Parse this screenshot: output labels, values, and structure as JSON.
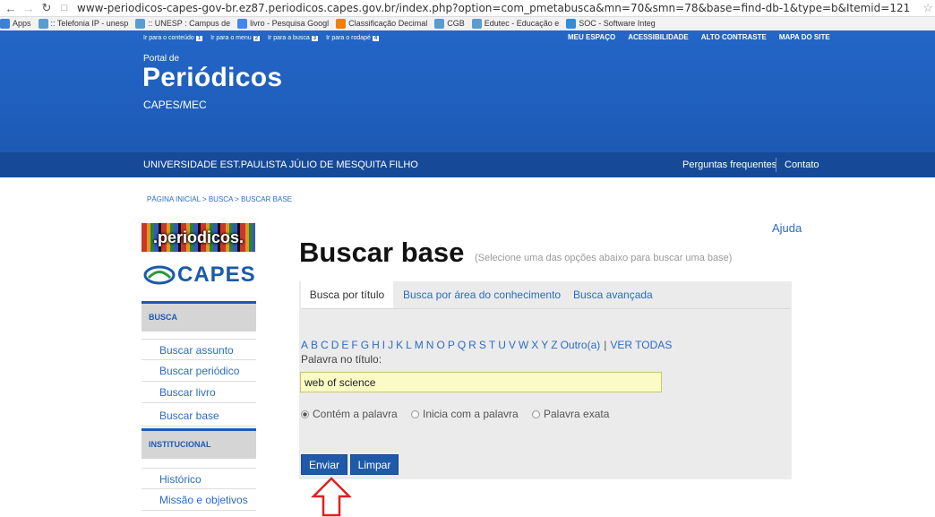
{
  "browser": {
    "url": "www-periodicos-capes-gov-br.ez87.periodicos.capes.gov.br/index.php?option=com_pmetabusca&mn=70&smn=78&base=find-db-1&type=b&Itemid=121",
    "bookmarks": [
      {
        "label": "Apps",
        "icon": "apps-grid-icon",
        "color": "#3b82d6"
      },
      {
        "label": ":: Telefonia IP - unesp",
        "icon": "unesp-icon",
        "color": "#5b9bd5"
      },
      {
        "label": ":: UNESP : Campus de",
        "icon": "unesp-icon",
        "color": "#5b9bd5"
      },
      {
        "label": "livro - Pesquisa Googl",
        "icon": "google-icon",
        "color": "#4285f4"
      },
      {
        "label": "Classificação Decimal",
        "icon": "blogger-icon",
        "color": "#f57d00"
      },
      {
        "label": "CGB",
        "icon": "unesp-icon",
        "color": "#5b9bd5"
      },
      {
        "label": "Edutec - Educação e",
        "icon": "unesp-icon",
        "color": "#5b9bd5"
      },
      {
        "label": "SOC - Software Integ",
        "icon": "soc-icon",
        "color": "#2e8fd6"
      }
    ]
  },
  "header": {
    "skip_links": [
      {
        "label": "Ir para o conteúdo",
        "num": "1"
      },
      {
        "label": "Ir para o menu",
        "num": "2"
      },
      {
        "label": "Ir para a busca",
        "num": "3"
      },
      {
        "label": "Ir para o rodapé",
        "num": "4"
      }
    ],
    "top_links": [
      "MEU ESPAÇO",
      "ACESSIBILIDADE",
      "ALTO CONTRASTE",
      "MAPA DO SITE"
    ],
    "portal_de": "Portal de",
    "title": "Periódicos",
    "subtitle": "CAPES/MEC",
    "university": "UNIVERSIDADE EST.PAULISTA JÚLIO DE MESQUITA FILHO",
    "faq": "Perguntas frequentes",
    "contact": "Contato",
    "brand_color": "#1d5ab6"
  },
  "breadcrumb": "PÁGINA INICIAL > BUSCA > BUSCAR BASE",
  "logos": {
    "periodicos": ".periodicos.",
    "capes": "CAPES"
  },
  "sidebar": {
    "busca_heading": "BUSCA",
    "busca_items": [
      "Buscar assunto",
      "Buscar periódico",
      "Buscar livro",
      "Buscar base"
    ],
    "institucional_heading": "INSTITUCIONAL",
    "institucional_items": [
      "Histórico",
      "Missão e objetivos"
    ]
  },
  "main": {
    "help": "Ajuda",
    "title": "Buscar base",
    "subtitle": "(Selecione uma das opções abaixo para buscar uma base)",
    "tabs": [
      "Busca por título",
      "Busca por área do conhecimento",
      "Busca avançada"
    ],
    "letters": [
      "A",
      "B",
      "C",
      "D",
      "E",
      "F",
      "G",
      "H",
      "I",
      "J",
      "K",
      "L",
      "M",
      "N",
      "O",
      "P",
      "Q",
      "R",
      "S",
      "T",
      "U",
      "V",
      "W",
      "X",
      "Y",
      "Z"
    ],
    "outro": "Outro(a)",
    "ver_todas": "VER TODAS",
    "field_label": "Palavra no título:",
    "field_value": "web of science",
    "radios": [
      "Contém a palavra",
      "Inicia com a palavra",
      "Palavra exata"
    ],
    "selected_radio": "Contém a palavra",
    "submit": "Enviar",
    "clear": "Limpar",
    "arrow_color": "#e02020"
  }
}
